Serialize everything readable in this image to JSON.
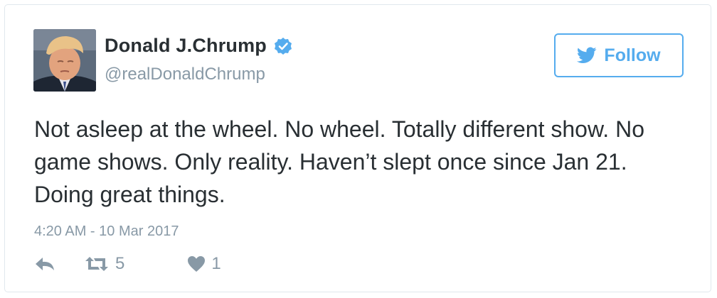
{
  "user": {
    "display_name": "Donald J.Chrump",
    "handle": "@realDonaldChrump",
    "verified_icon": "verified-badge-icon",
    "avatar_icon": "profile-photo"
  },
  "follow": {
    "label": "Follow",
    "icon": "twitter-bird-icon"
  },
  "tweet": {
    "text": "Not asleep at the wheel. No wheel. Totally different show. No game shows. Only reality. Haven’t slept once since Jan 21. Doing great things.",
    "timestamp": "4:20 AM - 10 Mar 2017"
  },
  "actions": {
    "reply_icon": "reply-icon",
    "retweet_icon": "retweet-icon",
    "retweet_count": "5",
    "like_icon": "heart-icon",
    "like_count": "1"
  },
  "colors": {
    "accent": "#55acee",
    "text": "#292f33",
    "muted": "#8899a6",
    "border": "#e1e8ed"
  }
}
